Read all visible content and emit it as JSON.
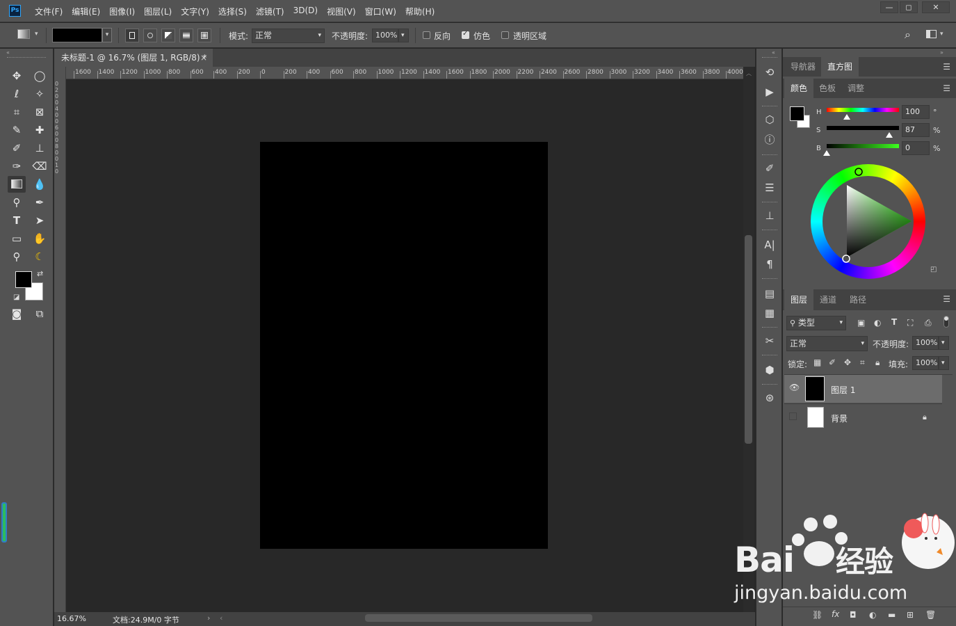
{
  "app": {
    "logo_text": "Ps"
  },
  "menu": {
    "items": [
      "文件(F)",
      "编辑(E)",
      "图像(I)",
      "图层(L)",
      "文字(Y)",
      "选择(S)",
      "滤镜(T)",
      "3D(D)",
      "视图(V)",
      "窗口(W)",
      "帮助(H)"
    ]
  },
  "options": {
    "mode_label": "模式:",
    "mode_value": "正常",
    "opacity_label": "不透明度:",
    "opacity_value": "100%",
    "reverse_label": "反向",
    "reverse_checked": false,
    "dither_label": "仿色",
    "dither_checked": true,
    "transparency_label": "透明区域",
    "transparency_checked": false
  },
  "document": {
    "tab_title": "未标题-1 @ 16.7% (图层 1, RGB/8) *",
    "close_glyph": "×",
    "ruler_h": [
      "1600",
      "1400",
      "1200",
      "1000",
      "800",
      "600",
      "400",
      "200",
      "0",
      "200",
      "400",
      "600",
      "800",
      "1000",
      "1200",
      "1400",
      "1600",
      "1800",
      "2000",
      "2200",
      "2400",
      "2600",
      "2800",
      "3000",
      "3200",
      "3400",
      "3600",
      "3800",
      "4000"
    ],
    "zoom": "16.67%",
    "doc_info": "文档:24.9M/0 字节",
    "fill_color": "#000000"
  },
  "panels": {
    "top_tabs": [
      "导航器",
      "直方图"
    ],
    "color_tabs": [
      "颜色",
      "色板",
      "调整"
    ],
    "hsb": [
      {
        "label": "H",
        "value": "100",
        "unit": "°",
        "fraction": 0.28
      },
      {
        "label": "S",
        "value": "87",
        "unit": "%",
        "fraction": 0.87
      },
      {
        "label": "B",
        "value": "0",
        "unit": "%",
        "fraction": 0.0
      }
    ],
    "layer_tabs": [
      "图层",
      "通道",
      "路径"
    ],
    "filter_label": "类型",
    "blend_mode": "正常",
    "opacity_label": "不透明度:",
    "opacity_value": "100%",
    "lock_label": "锁定:",
    "fill_label": "填充:",
    "fill_value": "100%",
    "layers": [
      {
        "name": "图层 1",
        "thumb": "#000000",
        "visible": true,
        "locked": false,
        "selected": true
      },
      {
        "name": "背景",
        "thumb": "#ffffff",
        "visible": false,
        "locked": true,
        "selected": false
      }
    ]
  },
  "colors": {
    "foreground": "#000000",
    "background": "#ffffff",
    "accent": "#31a8ff"
  },
  "watermark": {
    "brand": "Bai",
    "brand2": "经验",
    "url": "jingyan.baidu.com"
  }
}
